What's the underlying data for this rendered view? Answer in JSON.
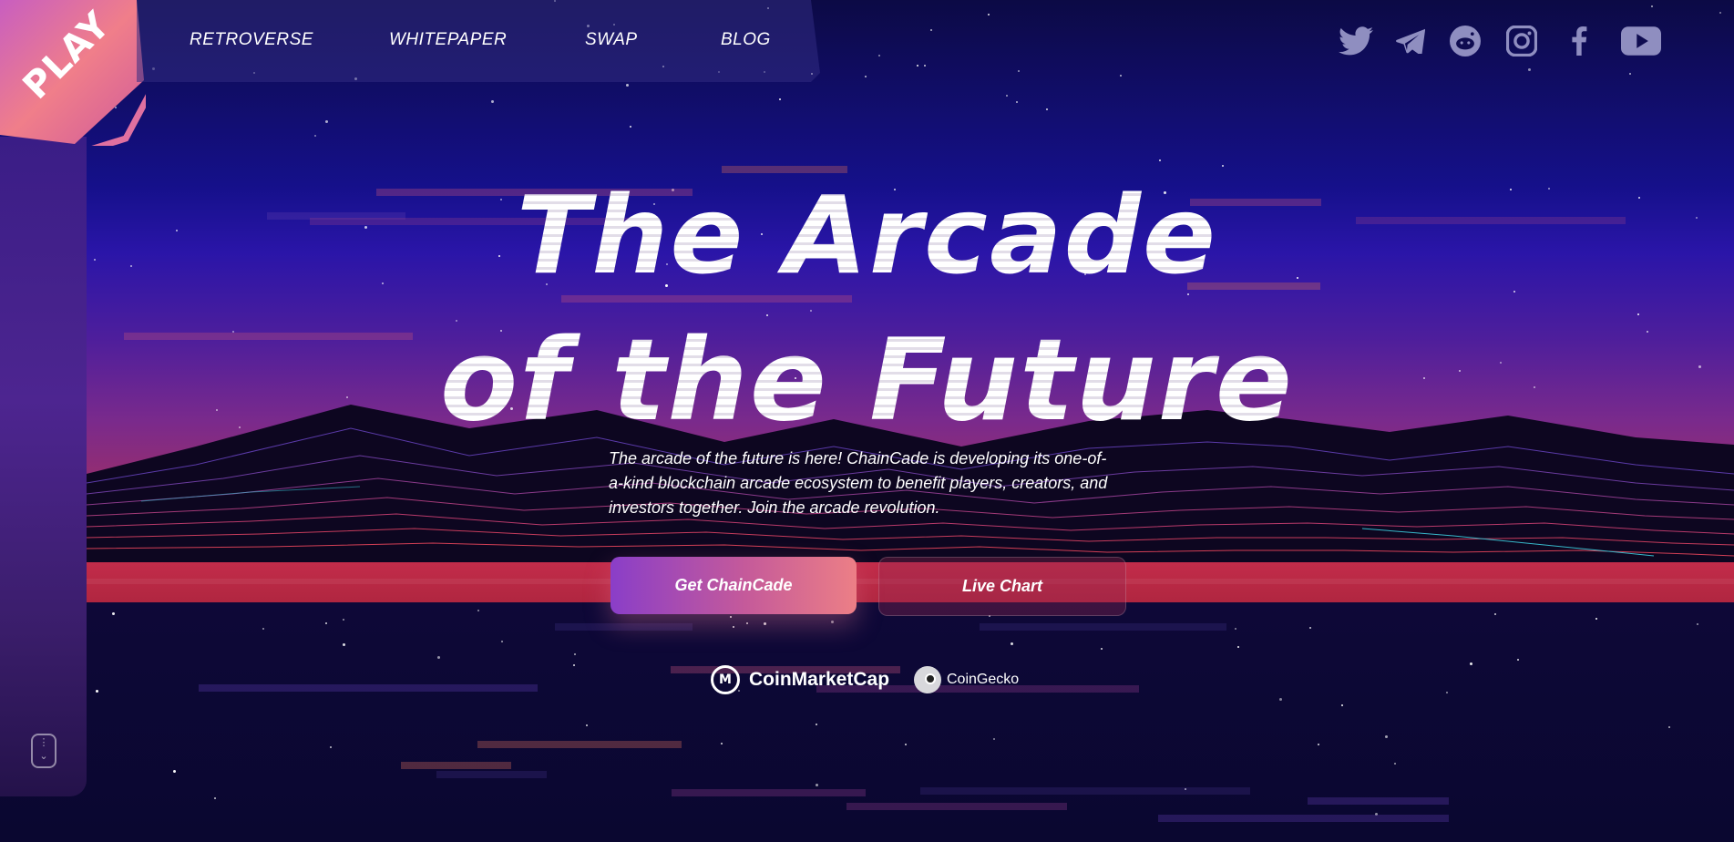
{
  "brand": {
    "play_label": "PLAY"
  },
  "nav": {
    "items": [
      {
        "label": "RETROVERSE"
      },
      {
        "label": "WHITEPAPER"
      },
      {
        "label": "SWAP"
      },
      {
        "label": "BLOG"
      }
    ]
  },
  "social": [
    {
      "icon": "twitter-icon"
    },
    {
      "icon": "telegram-icon"
    },
    {
      "icon": "reddit-icon"
    },
    {
      "icon": "instagram-icon"
    },
    {
      "icon": "facebook-icon"
    },
    {
      "icon": "youtube-icon"
    }
  ],
  "hero": {
    "title_line1": "The Arcade",
    "title_line2": "of the Future",
    "description": "The arcade of the future is here! ChainCade is developing its one-of-a-kind blockchain arcade ecosystem to benefit players, creators, and investors together. Join the arcade revolution.",
    "primary_button": "Get ChainCade",
    "secondary_button": "Live Chart"
  },
  "partners": {
    "cmc": "CoinMarketCap",
    "gecko": "CoinGecko"
  },
  "colors": {
    "accent_pink": "#ec7f86",
    "accent_purple": "#8a3ec8",
    "horizon_red": "#c32c4a",
    "sky_top": "#0c0a45"
  }
}
